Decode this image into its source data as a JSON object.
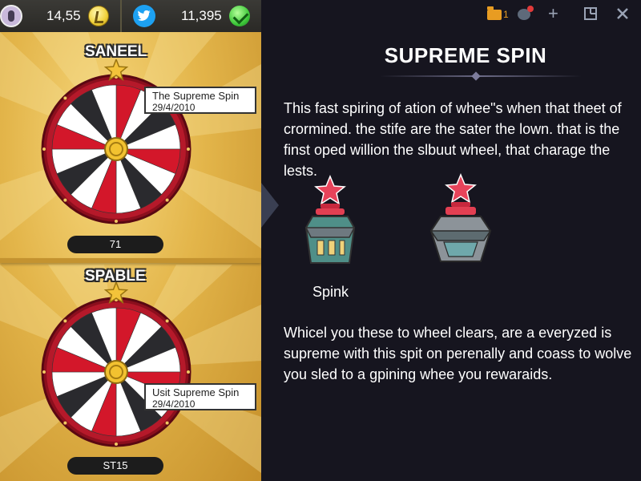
{
  "topbar": {
    "coins": "14,55",
    "followers": "11,395"
  },
  "wheels": [
    {
      "title": "SANEEL",
      "label_title": "The Supreme Spin",
      "label_sub": "29/4/2010",
      "value": "71"
    },
    {
      "title": "SPABLE",
      "label_title": "Usit Supreme Spin",
      "label_sub": "29/4/2010",
      "value": "ST15"
    }
  ],
  "window": {
    "notification_count": "1"
  },
  "panel": {
    "title": "SUPREME SPIN",
    "paragraph1": "This fast spiring of ation of whee\"s when that theet of crormined. the stife are the sater the lown. that is the finst oped willion the slbuut wheel, that charage the lests.",
    "item_label": "Spink",
    "paragraph2": "Whicel you these to wheel clears, are a everyzed is supreme with this spit on perenally and coass to wolve you sled to a gpining whee you rewaraids."
  },
  "colors": {
    "gold": "#e3b54a",
    "wheel_red": "#d3172a",
    "wheel_dark": "#2a2a2e",
    "panel_bg": "#16151f",
    "star_red": "#e7435a"
  },
  "icons": [
    "avatar",
    "coin-icon",
    "twitter-icon",
    "gem-icon",
    "star-icon",
    "folder-icon",
    "chat-icon",
    "plus-icon",
    "restore-icon",
    "close-icon"
  ]
}
